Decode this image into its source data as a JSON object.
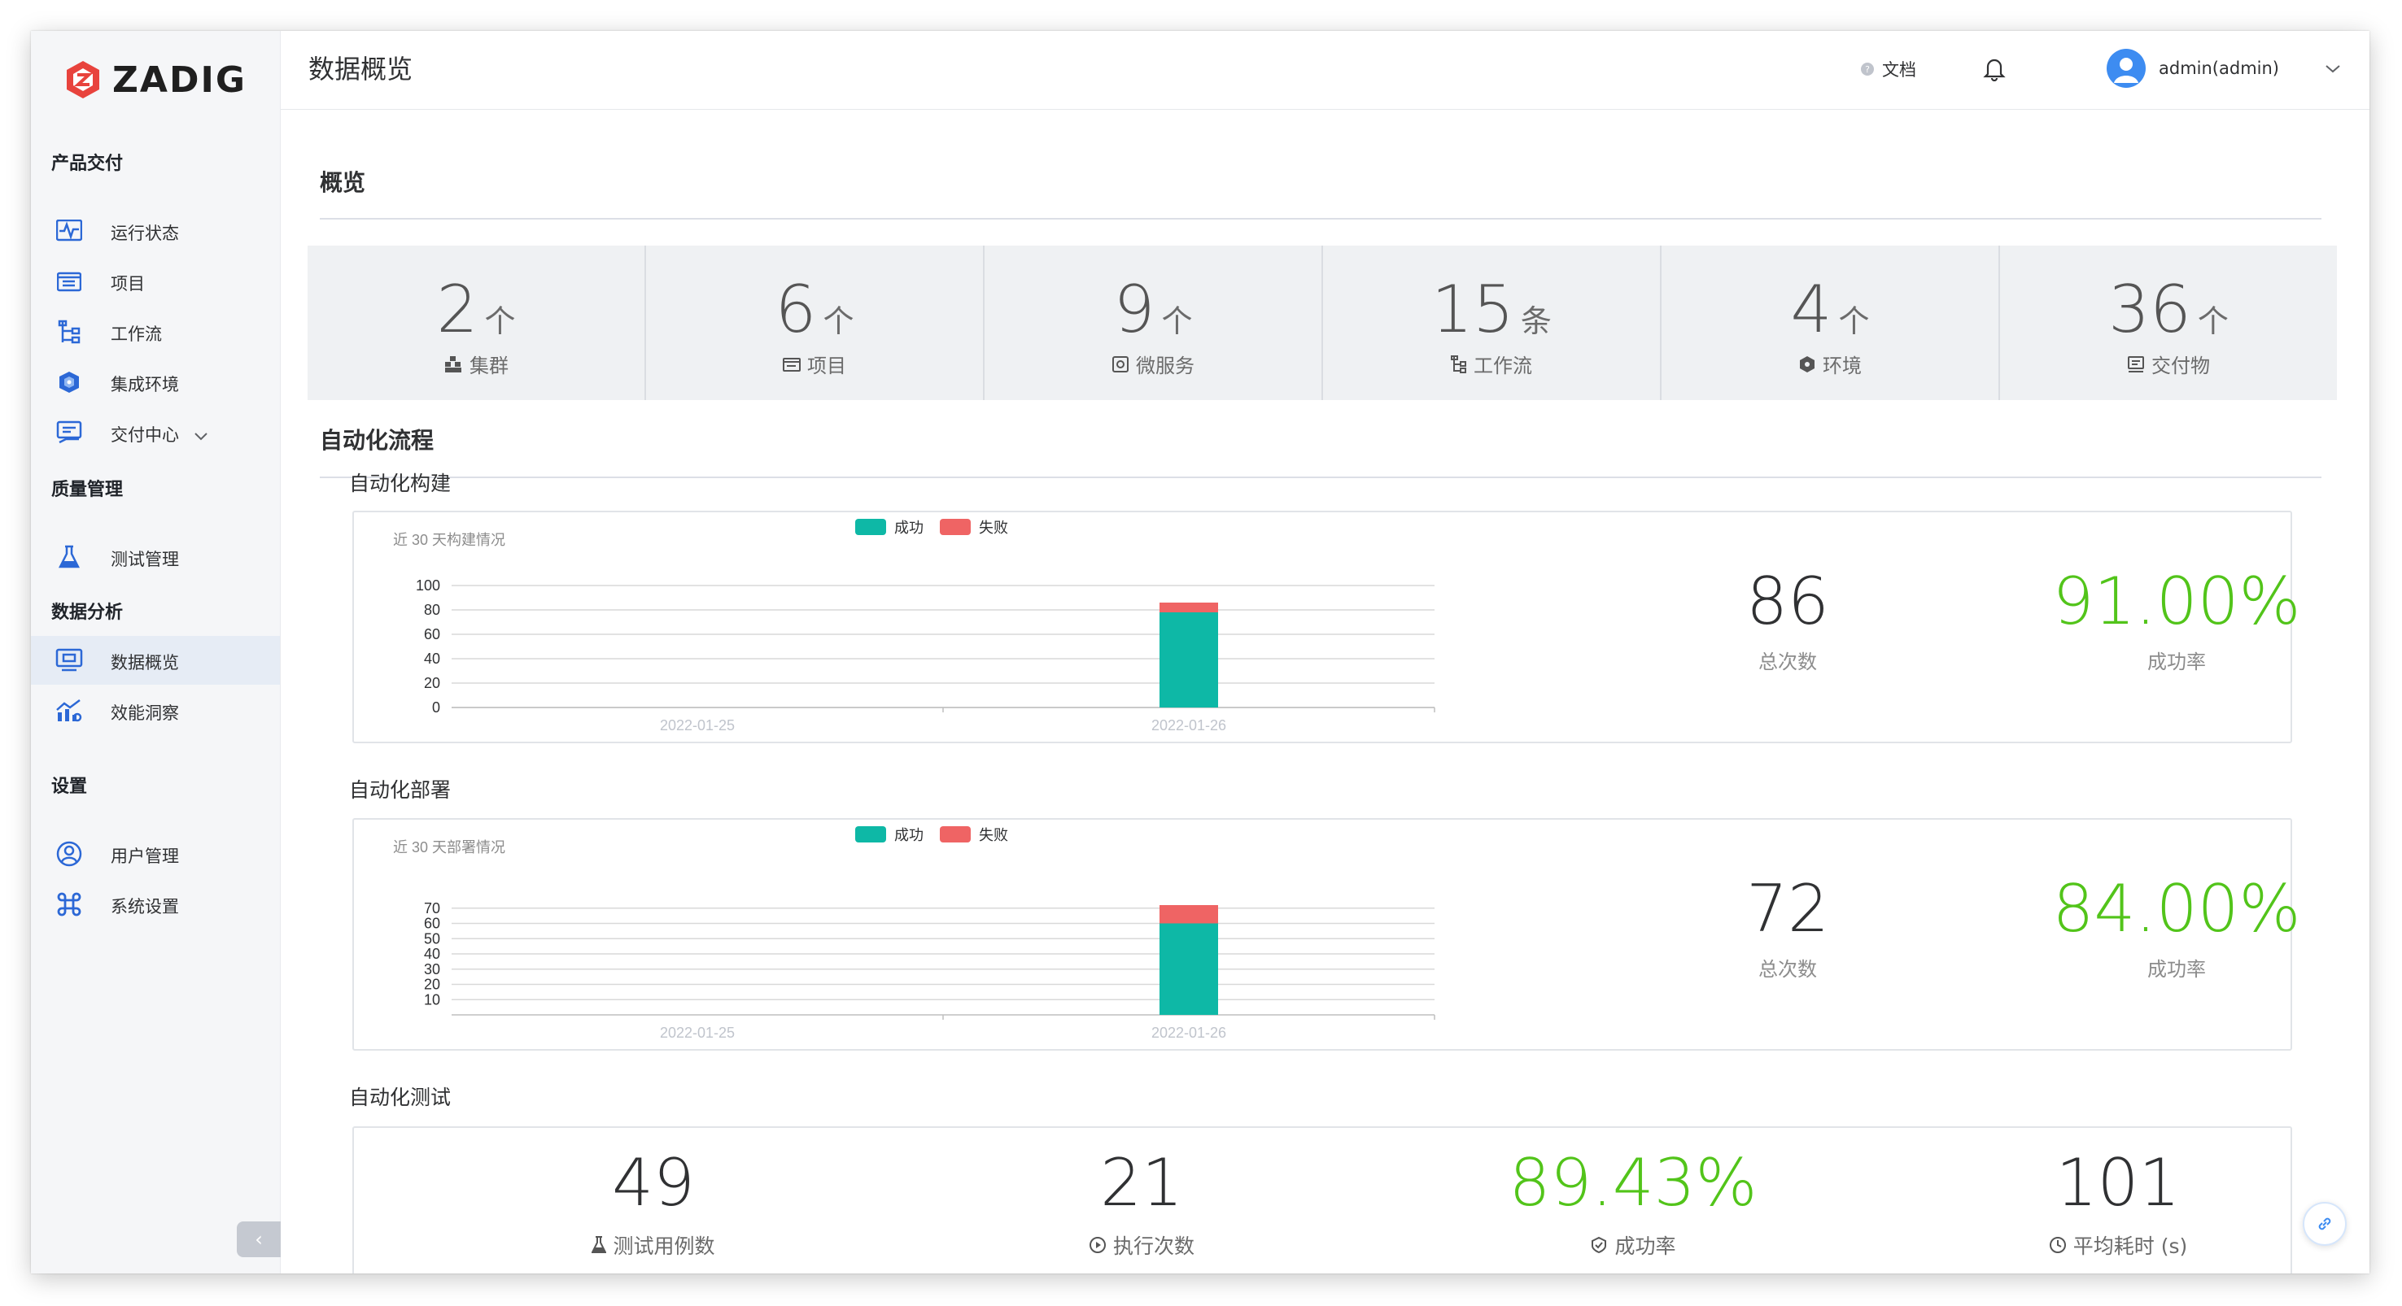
{
  "brand": {
    "name": "ZADIG",
    "accent": "#e8433d"
  },
  "header": {
    "title": "数据概览",
    "docs_label": "文档",
    "user_name": "admin(admin)"
  },
  "sidebar": {
    "groups": [
      {
        "title": "产品交付",
        "items": [
          {
            "label": "运行状态",
            "icon": "pulse-icon"
          },
          {
            "label": "项目",
            "icon": "project-icon"
          },
          {
            "label": "工作流",
            "icon": "workflow-icon"
          },
          {
            "label": "集成环境",
            "icon": "cube-icon"
          },
          {
            "label": "交付中心",
            "icon": "delivery-icon"
          }
        ]
      },
      {
        "title": "质量管理",
        "items": [
          {
            "label": "测试管理",
            "icon": "flask-icon"
          }
        ]
      },
      {
        "title": "数据分析",
        "items": [
          {
            "label": "数据概览",
            "icon": "monitor-icon",
            "active": true
          },
          {
            "label": "效能洞察",
            "icon": "insight-icon"
          }
        ]
      },
      {
        "title": "设置",
        "items": [
          {
            "label": "用户管理",
            "icon": "user-icon"
          },
          {
            "label": "系统设置",
            "icon": "command-icon"
          }
        ]
      }
    ]
  },
  "overview": {
    "title": "概览",
    "stats": [
      {
        "value": "2",
        "unit": "个",
        "label": "集群",
        "icon": "cluster-icon"
      },
      {
        "value": "6",
        "unit": "个",
        "label": "项目",
        "icon": "project-icon"
      },
      {
        "value": "9",
        "unit": "个",
        "label": "微服务",
        "icon": "service-icon"
      },
      {
        "value": "15",
        "unit": "条",
        "label": "工作流",
        "icon": "workflow-icon"
      },
      {
        "value": "4",
        "unit": "个",
        "label": "环境",
        "icon": "environment-icon"
      },
      {
        "value": "36",
        "unit": "个",
        "label": "交付物",
        "icon": "artifact-icon"
      }
    ]
  },
  "automation": {
    "title": "自动化流程",
    "build": {
      "title": "自动化构建",
      "total": "86",
      "total_label": "总次数",
      "rate": "91.00%",
      "rate_label": "成功率"
    },
    "deploy": {
      "title": "自动化部署",
      "total": "72",
      "total_label": "总次数",
      "rate": "84.00%",
      "rate_label": "成功率"
    },
    "test": {
      "title": "自动化测试",
      "kpis": [
        {
          "value": "49",
          "label": "测试用例数",
          "icon": "flask-icon"
        },
        {
          "value": "21",
          "label": "执行次数",
          "icon": "play-circle-icon"
        },
        {
          "value": "89.43%",
          "label": "成功率",
          "icon": "shield-check-icon",
          "green": true
        },
        {
          "value": "101",
          "label": "平均耗时 (s)",
          "icon": "clock-icon"
        }
      ]
    }
  },
  "chart_data": [
    {
      "type": "bar",
      "title": "近 30 天构建情况",
      "categories": [
        "2022-01-25",
        "2022-01-26"
      ],
      "series": [
        {
          "name": "成功",
          "values": [
            0,
            78
          ],
          "color": "#0eb8a6"
        },
        {
          "name": "失败",
          "values": [
            0,
            8
          ],
          "color": "#ef6464"
        }
      ],
      "stacked": true,
      "yticks": [
        0,
        20,
        40,
        60,
        80,
        100
      ],
      "ylim": [
        0,
        100
      ],
      "legend": "top-center"
    },
    {
      "type": "bar",
      "title": "近 30 天部署情况",
      "categories": [
        "2022-01-25",
        "2022-01-26"
      ],
      "series": [
        {
          "name": "成功",
          "values": [
            0,
            60
          ],
          "color": "#0eb8a6"
        },
        {
          "name": "失败",
          "values": [
            0,
            12
          ],
          "color": "#ef6464"
        }
      ],
      "stacked": true,
      "yticks": [
        10,
        20,
        30,
        40,
        50,
        60,
        70
      ],
      "ylim": [
        0,
        80
      ],
      "legend": "top-center"
    }
  ]
}
